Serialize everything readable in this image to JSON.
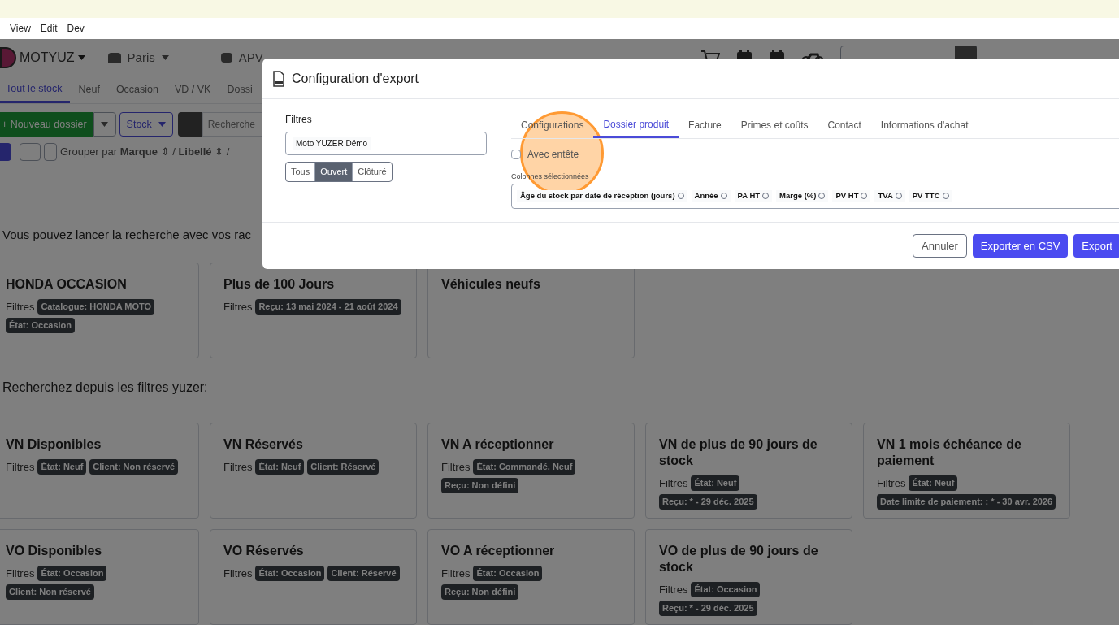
{
  "menu_bar": [
    "View",
    "Edit",
    "Dev"
  ],
  "header": {
    "brand": "MOTYUZ",
    "site": "Paris",
    "module": "APV"
  },
  "tabs": [
    {
      "label": "Tout le stock",
      "selected": true
    },
    {
      "label": "Neuf",
      "selected": false
    },
    {
      "label": "Occasion",
      "selected": false
    },
    {
      "label": "VD / VK",
      "selected": false
    },
    {
      "label": "Dossi",
      "selected": false
    }
  ],
  "toolbar": {
    "new_button": "+ Nouveau dossier",
    "stock_button": "Stock",
    "search_placeholder": "Recherche"
  },
  "group_by": "Grouper par **Marque** ⇕ / **Libellé** ⇕ /",
  "saved_searches": {
    "title": "Vous pouvez lancer la recherche avec vos rac",
    "cards": [
      {
        "title": "HONDA OCCASION",
        "filters_label": "Filtres",
        "tags": [
          "Catalogue: HONDA MOTO",
          "État: Occasion"
        ]
      },
      {
        "title": "Plus de 100 Jours",
        "filters_label": "Filtres",
        "tags": [
          "Reçu: 13 mai 2024 - 21 août 2024"
        ]
      },
      {
        "title": "Véhicules neufs"
      }
    ]
  },
  "yuzer_filters": {
    "title": "Recherchez depuis les filtres yuzer:",
    "rows": [
      [
        {
          "title": "VN Disponibles",
          "filters_label": "Filtres",
          "tags": [
            "État: Neuf",
            "Client: Non réservé"
          ]
        },
        {
          "title": "VN Réservés",
          "filters_label": "Filtres",
          "tags": [
            "État: Neuf",
            "Client: Réservé"
          ]
        },
        {
          "title": "VN A réceptionner",
          "filters_label": "Filtres",
          "tags": [
            "État: Commandé, Neuf",
            "Reçu: Non défini"
          ]
        },
        {
          "title": "VN de plus de 90 jours de stock",
          "filters_label": "Filtres",
          "tags": [
            "État: Neuf",
            "Reçu: * - 29 déc. 2025"
          ]
        },
        {
          "title": "VN 1 mois échéance de paiement",
          "filters_label": "Filtres",
          "tags": [
            "État: Neuf",
            "Date limite de paiement: : * - 30 avr. 2026"
          ]
        }
      ],
      [
        {
          "title": "VO Disponibles",
          "filters_label": "Filtres",
          "tags": [
            "État: Occasion",
            "Client: Non réservé"
          ]
        },
        {
          "title": "VO Réservés",
          "filters_label": "Filtres",
          "tags": [
            "État: Occasion",
            "Client: Réservé"
          ]
        },
        {
          "title": "VO A réceptionner",
          "filters_label": "Filtres",
          "tags": [
            "État: Occasion",
            "Reçu: Non défini"
          ]
        },
        {
          "title": "VO de plus de 90 jours de stock",
          "filters_label": "Filtres",
          "tags": [
            "État: Occasion",
            "Reçu: * - 29 déc. 2025"
          ]
        }
      ]
    ]
  },
  "modal": {
    "title": "Configuration d'export",
    "filters_label": "Filtres",
    "filter_value": "Moto YUZER Démo",
    "status_options": [
      {
        "label": "Tous",
        "selected": false
      },
      {
        "label": "Ouvert",
        "selected": true
      },
      {
        "label": "Clôturé",
        "selected": false
      }
    ],
    "tabs": [
      {
        "label": "Configurations",
        "selected": false
      },
      {
        "label": "Dossier produit",
        "selected": true
      },
      {
        "label": "Facture",
        "selected": false
      },
      {
        "label": "Primes et coûts",
        "selected": false
      },
      {
        "label": "Contact",
        "selected": false
      },
      {
        "label": "Informations d'achat",
        "selected": false
      }
    ],
    "header_checkbox": {
      "label": "Avec entête",
      "checked": false
    },
    "columns_label": "Colonnes sélectionnées",
    "columns": [
      "Âge du stock par date de réception (jours)",
      "Année",
      "PA HT",
      "Marge (%)",
      "PV HT",
      "TVA",
      "PV TTC"
    ],
    "buttons": [
      {
        "label": "Annuler",
        "kind": "secondary"
      },
      {
        "label": "Exporter en CSV",
        "kind": "primary"
      },
      {
        "label": "Export",
        "kind": "primary"
      }
    ]
  }
}
